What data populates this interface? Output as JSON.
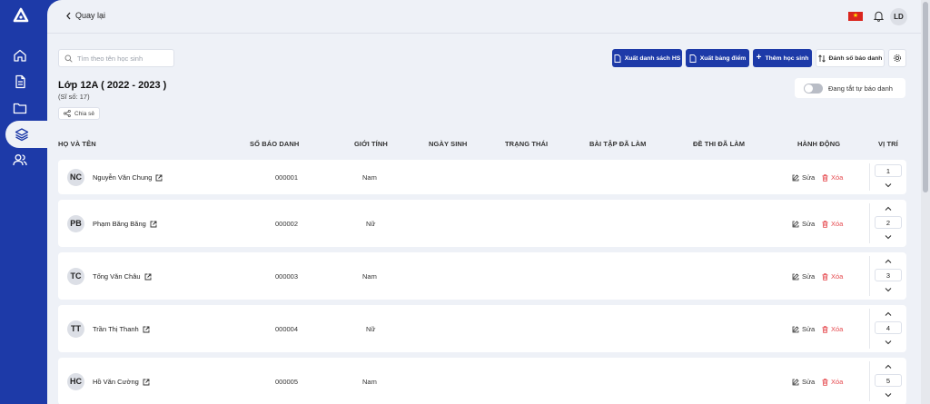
{
  "topbar": {
    "back_label": "Quay lại",
    "user_initials": "LD",
    "language_flag": "vietnam-flag"
  },
  "sidebar": {
    "items": [
      {
        "icon": "home-icon"
      },
      {
        "icon": "document-icon"
      },
      {
        "icon": "folder-icon"
      },
      {
        "icon": "layers-icon",
        "active": true
      },
      {
        "icon": "users-icon"
      }
    ]
  },
  "search": {
    "placeholder": "Tìm theo tên học sinh",
    "value": ""
  },
  "toolbar": {
    "export_students": "Xuất danh sách HS",
    "export_scores": "Xuất bảng điểm",
    "add_student": "Thêm học sinh",
    "number_sbd": "Đánh số báo danh"
  },
  "class": {
    "title": "Lớp 12A ( 2022 - 2023 )",
    "count": "(Sĩ số: 17)",
    "share_label": "Chia sẻ"
  },
  "auto_number_toggle": {
    "label": "Đang tắt tự báo danh",
    "on": false
  },
  "table": {
    "headers": [
      "HỌ VÀ TÊN",
      "SỐ BÁO DANH",
      "GIỚI TÍNH",
      "NGÀY SINH",
      "TRẠNG THÁI",
      "BÀI TẬP ĐÃ LÀM",
      "ĐỀ THI ĐÃ LÀM",
      "HÀNH ĐỘNG",
      "VỊ TRÍ"
    ],
    "edit_label": "Sửa",
    "delete_label": "Xóa",
    "rows": [
      {
        "initials": "NC",
        "name": "Nguyễn Văn Chung",
        "sbd": "000001",
        "gender": "Nam",
        "position": "1"
      },
      {
        "initials": "PB",
        "name": "Phạm Băng Băng",
        "sbd": "000002",
        "gender": "Nữ",
        "position": "2"
      },
      {
        "initials": "TC",
        "name": "Tống Văn Châu",
        "sbd": "000003",
        "gender": "Nam",
        "position": "3"
      },
      {
        "initials": "TT",
        "name": "Trần Thị Thanh",
        "sbd": "000004",
        "gender": "Nữ",
        "position": "4"
      },
      {
        "initials": "HC",
        "name": "Hồ Văn Cường",
        "sbd": "000005",
        "gender": "Nam",
        "position": "5"
      }
    ]
  },
  "colors": {
    "primary": "#1d3aa8",
    "danger": "#e5484d",
    "background": "#eef1f7"
  }
}
